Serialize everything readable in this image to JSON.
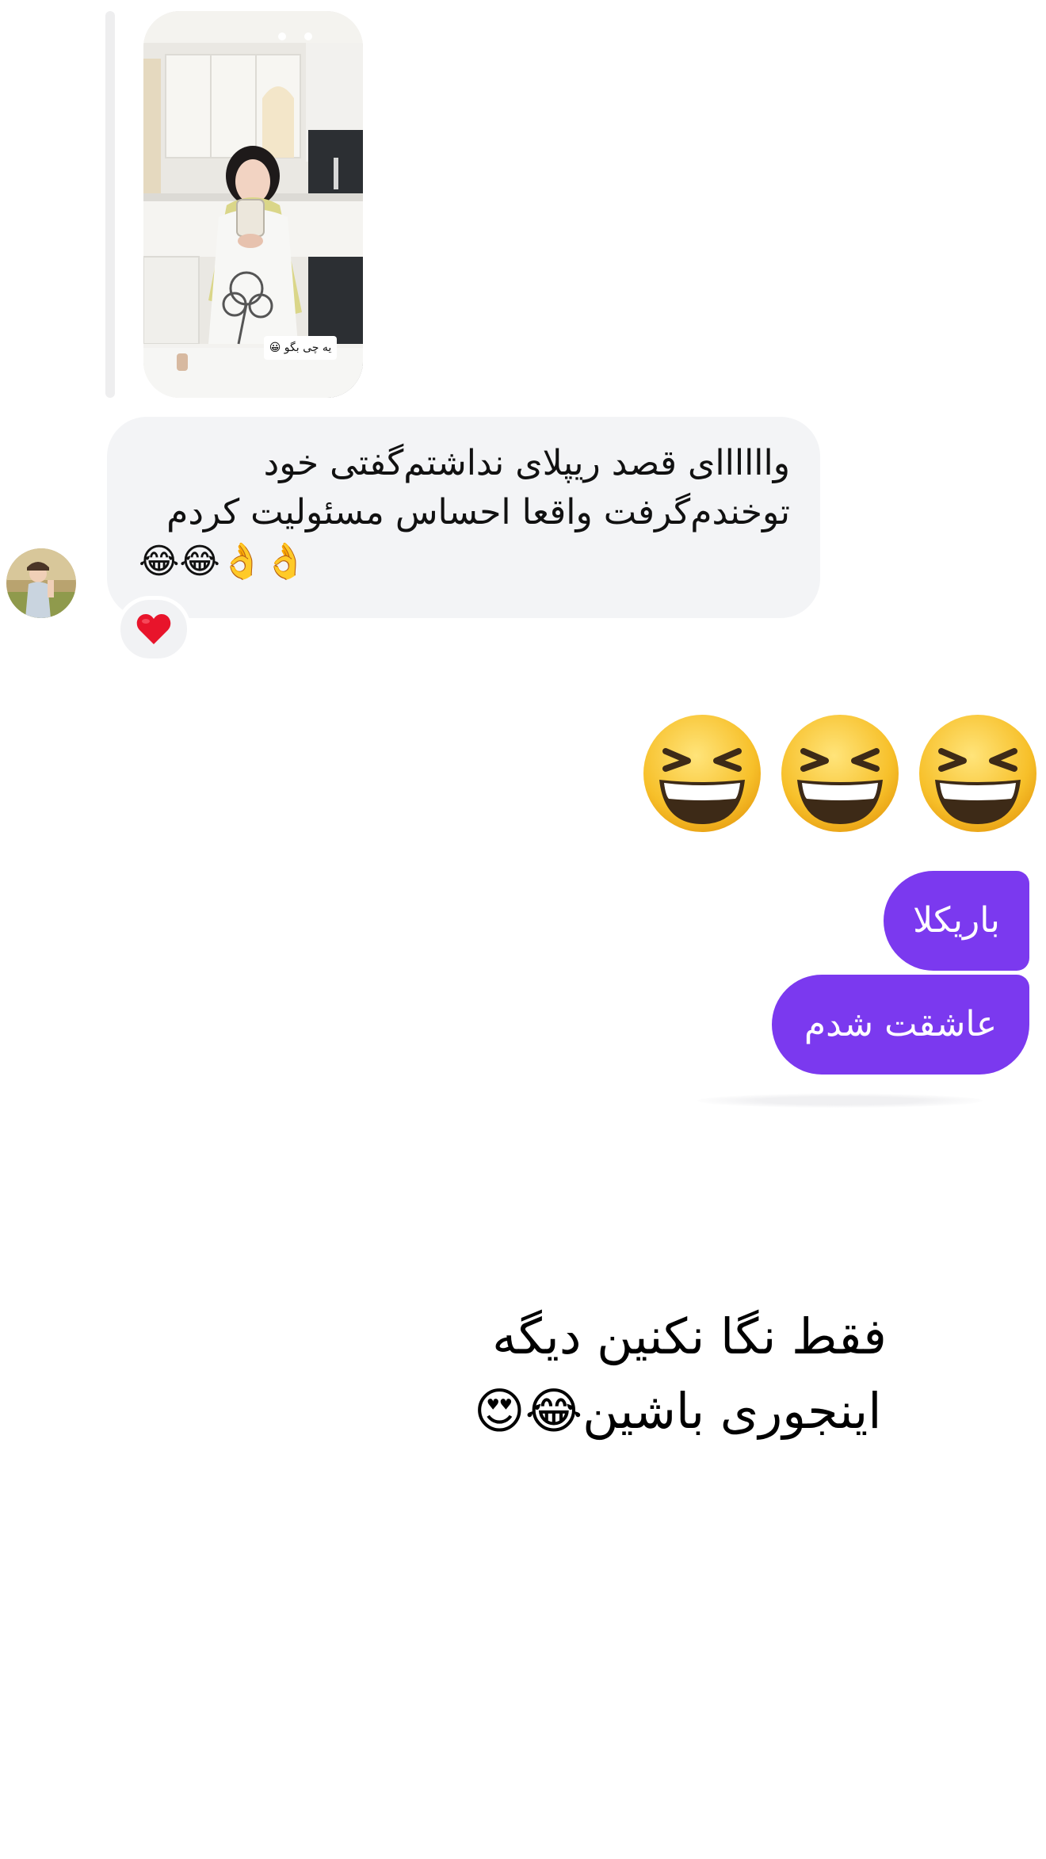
{
  "story_reply": {
    "sticker_text": "یه چی بگو 😀"
  },
  "incoming_message": {
    "lines": [
      "واااااای قصد ریپلای نداشتم‌گفتی خود",
      "توخندم‌گرفت واقعا احساس مسئولیت کردم",
      "😂😂👌👌"
    ],
    "reaction": "❤️"
  },
  "big_emojis": [
    "😆",
    "😆",
    "😆"
  ],
  "outgoing_messages": [
    "باریکلا",
    "عاشقت شدم"
  ],
  "caption": {
    "line1": "فقط نگا نکنین دیگه",
    "line2": "اینجوری باشین😂😍"
  },
  "colors": {
    "outgoing_bubble": "#7b39ef",
    "incoming_bubble": "#f3f4f6",
    "reaction_bg": "#f1f2f4",
    "reply_bar": "#eeeeef"
  }
}
